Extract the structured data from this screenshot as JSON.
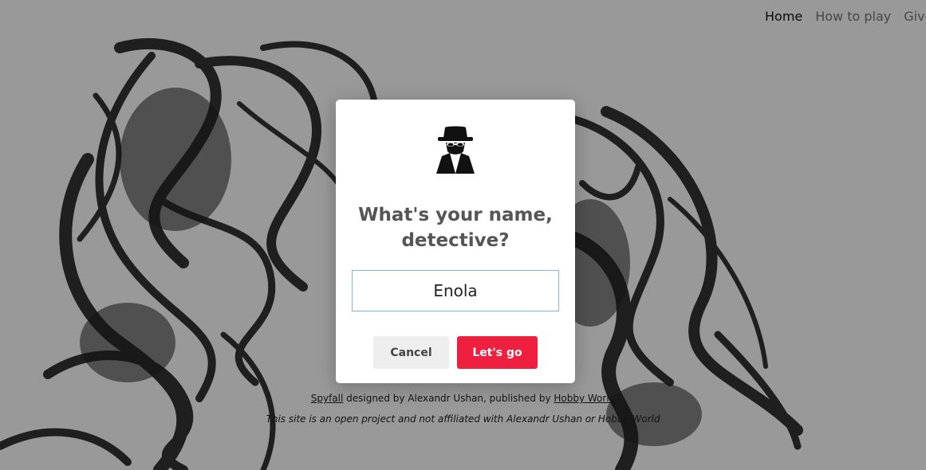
{
  "nav": {
    "items": [
      {
        "label": "Home"
      },
      {
        "label": "How to play"
      },
      {
        "label": "Give"
      }
    ]
  },
  "footer": {
    "line1": {
      "game_link": "Spyfall",
      "designed_text": " designed by Alexandr Ushan, published by ",
      "publisher_link": "Hobby World"
    },
    "line2": "This site is an open project and not affiliated with Alexandr Ushan or Hobby World"
  },
  "modal": {
    "icon": "spy-icon",
    "title": "What's your name, detective?",
    "name_input_value": "Enola",
    "cancel_label": "Cancel",
    "submit_label": "Let's go"
  },
  "colors": {
    "accent": "#ee1f3f",
    "input_border": "#7fb7e6",
    "title_text": "#555555"
  }
}
